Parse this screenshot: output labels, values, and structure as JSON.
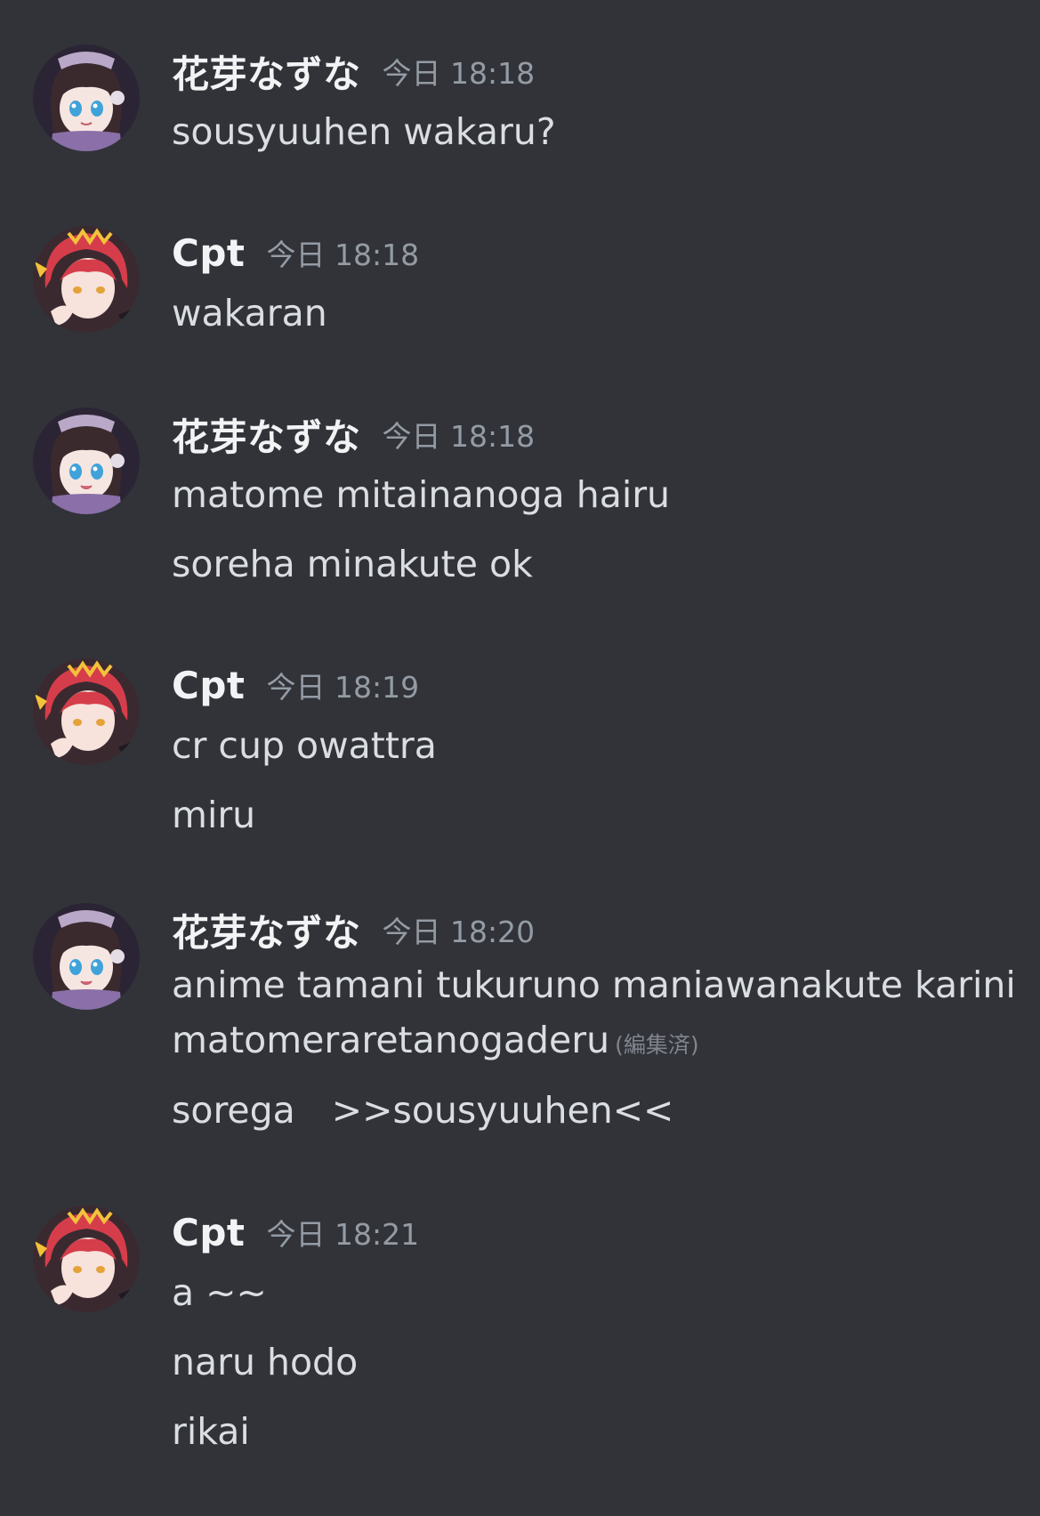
{
  "colors": {
    "background": "#313338",
    "username": "#f2f3f5",
    "timestamp": "#949ba4",
    "message_text": "#dbdee1",
    "edited": "#80848e"
  },
  "messages": [
    {
      "avatar_icon": "anime-girl-avatar-icon",
      "username": "花芽なずな",
      "timestamp": "今日 18:18",
      "lines": [
        "sousyuuhen wakaru?"
      ]
    },
    {
      "avatar_icon": "anime-redhair-avatar-icon",
      "username": "Cpt",
      "timestamp": "今日 18:18",
      "lines": [
        "wakaran"
      ]
    },
    {
      "avatar_icon": "anime-girl-avatar-icon",
      "username": "花芽なずな",
      "timestamp": "今日 18:18",
      "lines": [
        "matome mitainanoga hairu",
        "soreha minakute ok"
      ]
    },
    {
      "avatar_icon": "anime-redhair-avatar-icon",
      "username": "Cpt",
      "timestamp": "今日 18:19",
      "lines": [
        "cr cup owattra",
        "miru"
      ]
    },
    {
      "avatar_icon": "anime-girl-avatar-icon",
      "username": "花芽なずな",
      "timestamp": "今日 18:20",
      "lines": [
        "anime tamani tukuruno maniawanakute karini",
        "matomeraretanogaderu",
        "sorega　>>sousyuuhen<<"
      ],
      "edited_label": "(編集済)"
    },
    {
      "avatar_icon": "anime-redhair-avatar-icon",
      "username": "Cpt",
      "timestamp": "今日 18:21",
      "lines": [
        "a ~~",
        "naru hodo",
        "rikai"
      ]
    }
  ]
}
